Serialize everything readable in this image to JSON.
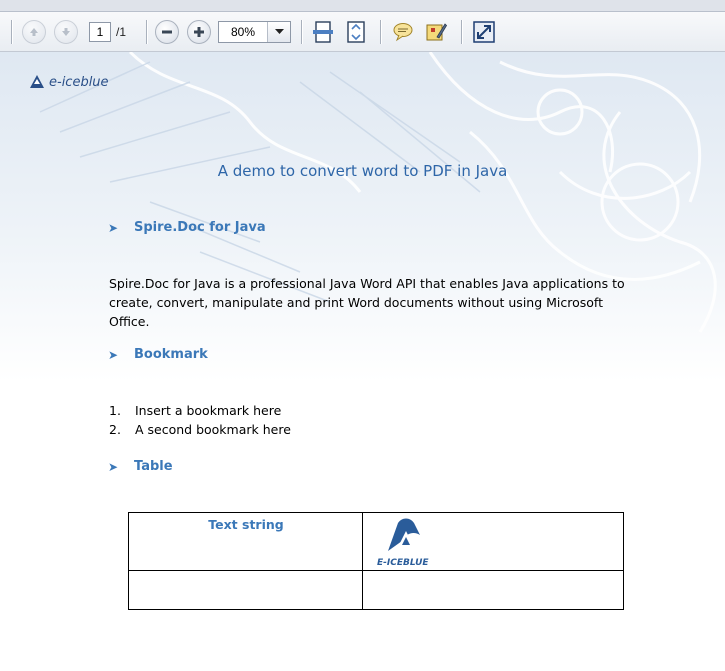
{
  "toolbar": {
    "page_current": "1",
    "page_total": "/1",
    "zoom": "80%"
  },
  "document": {
    "logo_text": "e-iceblue",
    "title": "A demo to convert word to PDF in Java",
    "section1_heading": "Spire.Doc for Java",
    "paragraph": "Spire.Doc for Java is a professional Java Word API that enables Java applications to create, convert, manipulate and print Word documents without using Microsoft Office.",
    "section2_heading": "Bookmark",
    "list": [
      {
        "num": "1.",
        "text": "Insert a bookmark here"
      },
      {
        "num": "2.",
        "text": "A second bookmark here"
      }
    ],
    "section3_heading": "Table",
    "table": {
      "cell_text": "Text string",
      "cell_logo_text": "E-ICEBLUE"
    }
  },
  "colors": {
    "heading": "#3b78b8",
    "title": "#2e66a8",
    "background_frost": "#dfe8f2"
  }
}
